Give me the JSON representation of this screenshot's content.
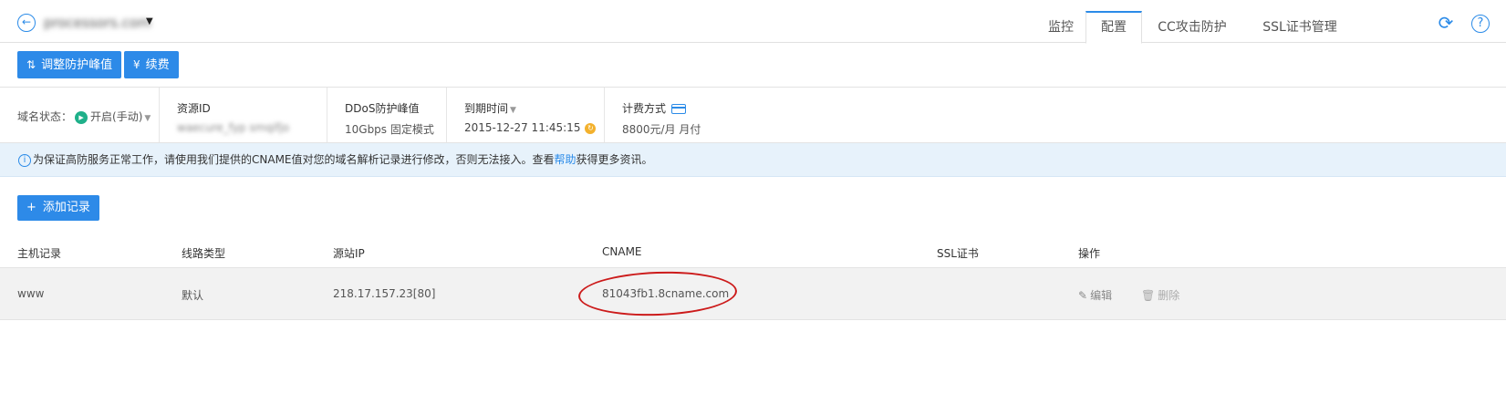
{
  "header": {
    "domain": "processors.com",
    "tabs": [
      {
        "label": "监控",
        "active": false
      },
      {
        "label": "配置",
        "active": true
      },
      {
        "label": "CC攻击防护",
        "active": false
      },
      {
        "label": "SSL证书管理",
        "active": false
      }
    ],
    "icons": {
      "back": "back-arrow-icon",
      "refresh": "refresh-icon",
      "help": "help-icon"
    }
  },
  "toolbar": {
    "adjust_label": "调整防护峰值",
    "renew_label": "续费"
  },
  "info": {
    "status_label": "域名状态：",
    "status_value": "开启(手动)",
    "resource_label": "资源ID",
    "resource_value": "waecure_fyp smqifjo",
    "ddos_label": "DDoS防护峰值",
    "ddos_value": "10Gbps 固定模式",
    "expire_label": "到期时间",
    "expire_value": "2015-12-27 11:45:15",
    "billing_label": "计费方式",
    "billing_value": "8800元/月 月付"
  },
  "notice": {
    "text_before": "为保证高防服务正常工作，请使用我们提供的CNAME值对您的域名解析记录进行修改，否则无法接入。查看",
    "link": "帮助",
    "text_after": "获得更多资讯。"
  },
  "records": {
    "add_label": "添加记录",
    "columns": [
      "主机记录",
      "线路类型",
      "源站IP",
      "CNAME",
      "SSL证书",
      "操作"
    ],
    "rows": [
      {
        "host": "www",
        "line": "默认",
        "ip": "218.17.157.23[80]",
        "cname": "81043fb1.8cname.com",
        "ssl": "",
        "edit": "编辑",
        "delete": "删除"
      }
    ]
  },
  "colors": {
    "accent": "#2d8ae8",
    "status_green": "#1fb08a",
    "highlight_red": "#cc1b1b",
    "notice_bg": "#e7f2fb"
  }
}
